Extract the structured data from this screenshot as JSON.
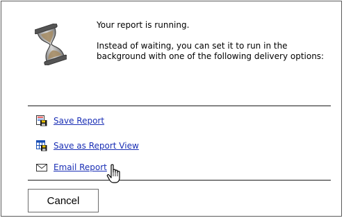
{
  "message": {
    "line1": "Your report is running.",
    "line2": "Instead of waiting, you can set it to run in the background with one of the following delivery options:"
  },
  "options": [
    {
      "label": "Save Report",
      "icon": "save-report-icon"
    },
    {
      "label": "Save as Report View",
      "icon": "save-report-view-icon"
    },
    {
      "label": "Email Report",
      "icon": "envelope-icon"
    }
  ],
  "buttons": {
    "cancel": "Cancel"
  },
  "colors": {
    "link": "#1a2fb5",
    "border": "#5a5a5a"
  }
}
